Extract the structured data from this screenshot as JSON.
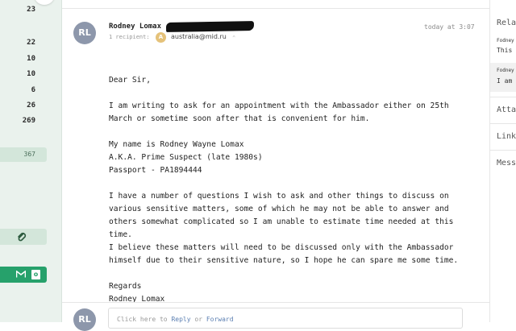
{
  "sidebar": {
    "counts": [
      "23",
      "22",
      "10",
      "10",
      "6",
      "26",
      "269"
    ],
    "badge_count": "367"
  },
  "message": {
    "sender_avatar_initials": "RL",
    "sender_name": "Rodney Lomax",
    "timestamp": "today at 3:07",
    "recipients_label": "1 recipient:",
    "recipient_avatar_initial": "A",
    "recipient_email": "australia@mid.ru",
    "body_lines": [
      "Dear Sir,",
      "",
      "I am writing to ask for an appointment with the Ambassador either on 25th",
      "March or sometime soon after that is convenient for him.",
      "",
      "My name is Rodney Wayne Lomax",
      "A.K.A. Prime Suspect (late 1980s)",
      "Passport - PA1894444",
      "",
      "I have a number of questions I wish to ask and other things to discuss on",
      "various sensitive matters, some of which he may not be able to answer and",
      "others somewhat complicated so I am unable to estimate time needed at this",
      "time.",
      "I believe these matters will need to be discussed only with the Ambassador",
      "himself due to their sensitive nature, so I hope he can spare me some time.",
      "",
      "Regards",
      "Rodney Lomax"
    ]
  },
  "reply": {
    "avatar_initials": "RL",
    "prompt_prefix": "Click here to",
    "reply_link": "Reply",
    "or_text": "or",
    "forward_link": "Forward"
  },
  "right_panel": {
    "related_title": "Rela",
    "item1_from": "Fodney",
    "item1_snippet": "This m",
    "item2_from": "Fodney",
    "item2_snippet": "I am w",
    "attachments_title": "Atta",
    "links_title": "Link",
    "messages_title": "Mess"
  },
  "colors": {
    "sidebar_bg": "#eaf2ed",
    "accent_green": "#26a16b",
    "avatar_gray": "#8d97ab"
  }
}
